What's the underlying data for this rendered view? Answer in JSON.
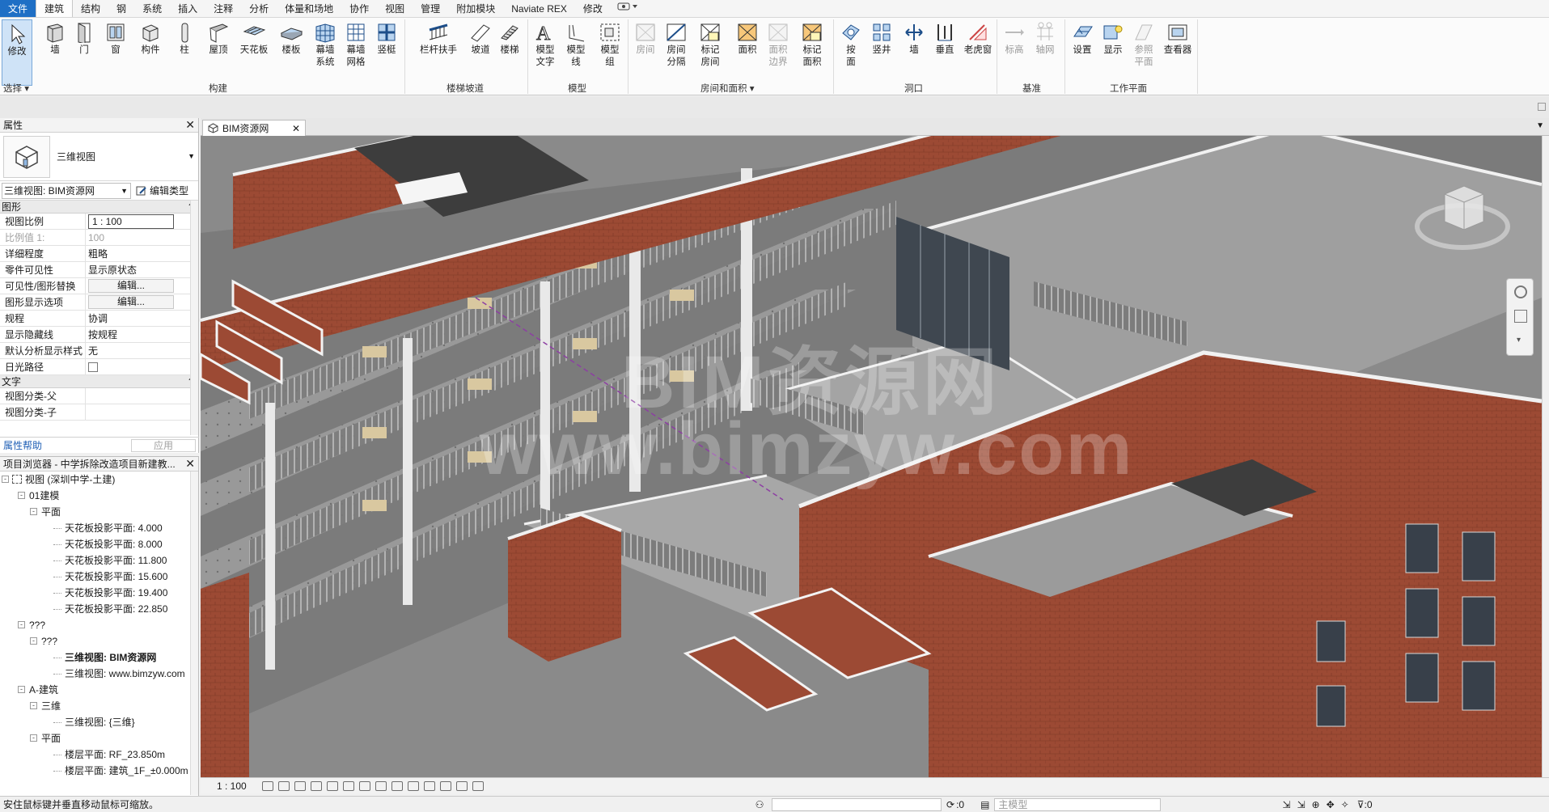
{
  "menu": {
    "tabs": [
      "文件",
      "建筑",
      "结构",
      "钢",
      "系统",
      "插入",
      "注释",
      "分析",
      "体量和场地",
      "协作",
      "视图",
      "管理",
      "附加模块",
      "Naviate REX",
      "修改"
    ],
    "active": "建筑"
  },
  "ribbon": {
    "select_label": "选择",
    "tools": {
      "modify": "修改",
      "wall": "墙",
      "door": "门",
      "window": "窗",
      "component": "构件",
      "column": "柱",
      "roof": "屋顶",
      "ceiling": "天花板",
      "floor": "楼板",
      "curtain_system": "幕墙\n系统",
      "curtain_grid": "幕墙\n网格",
      "mullion": "竖梃",
      "railing": "栏杆扶手",
      "ramp": "坡道",
      "stair": "楼梯",
      "model_text": "模型\n文字",
      "model_line": "模型\n线",
      "model_group": "模型\n组",
      "room": "房间",
      "room_separator": "房间\n分隔",
      "tag_room": "标记\n房间",
      "area": "面积",
      "area_boundary": "面积\n边界",
      "tag_area": "标记\n面积",
      "by_face": "按\n面",
      "shaft": "竖井",
      "wall_opening": "墙",
      "vertical": "垂直",
      "dormer": "老虎窗",
      "level": "标高",
      "grid": "轴网",
      "set": "设置",
      "show": "显示",
      "ref_plane": "参照\n平面",
      "viewer": "查看器"
    },
    "panels": {
      "build": "构建",
      "circulation": "楼梯坡道",
      "model": "模型",
      "room_area": "房间和面积",
      "opening": "洞口",
      "datum": "基准",
      "work_plane": "工作平面"
    }
  },
  "properties": {
    "title": "属性",
    "type_name": "三维视图",
    "instance_selector": "三维视图: BIM资源网",
    "edit_type": "编辑类型",
    "groups": {
      "graphics": "图形",
      "text": "文字"
    },
    "rows": [
      {
        "key": "视图比例",
        "value": "1 : 100",
        "style": "boxed"
      },
      {
        "key": "比例值 1:",
        "value": "100",
        "style": "dim"
      },
      {
        "key": "详细程度",
        "value": "粗略",
        "style": "plain"
      },
      {
        "key": "零件可见性",
        "value": "显示原状态",
        "style": "plain"
      },
      {
        "key": "可见性/图形替换",
        "value": "编辑...",
        "style": "btn"
      },
      {
        "key": "图形显示选项",
        "value": "编辑...",
        "style": "btn"
      },
      {
        "key": "规程",
        "value": "协调",
        "style": "plain"
      },
      {
        "key": "显示隐藏线",
        "value": "按规程",
        "style": "plain"
      },
      {
        "key": "默认分析显示样式",
        "value": "无",
        "style": "plain"
      },
      {
        "key": "日光路径",
        "value": "",
        "style": "check"
      }
    ],
    "text_rows": [
      {
        "key": "视图分类-父",
        "value": ""
      },
      {
        "key": "视图分类-子",
        "value": ""
      }
    ],
    "help_link": "属性帮助",
    "apply_button": "应用"
  },
  "browser": {
    "title": "项目浏览器 - 中学拆除改造项目新建教...",
    "items": [
      {
        "label": "视图 (深圳中学-土建)",
        "level": 0,
        "toggle": "-",
        "icon": true,
        "bold": false
      },
      {
        "label": "01建模",
        "level": 1,
        "toggle": "-",
        "bold": false
      },
      {
        "label": "平面",
        "level": 2,
        "toggle": "-",
        "bold": false
      },
      {
        "label": "天花板投影平面: 4.000",
        "level": 3,
        "toggle": "",
        "bold": false
      },
      {
        "label": "天花板投影平面: 8.000",
        "level": 3,
        "toggle": "",
        "bold": false
      },
      {
        "label": "天花板投影平面: 11.800",
        "level": 3,
        "toggle": "",
        "bold": false
      },
      {
        "label": "天花板投影平面: 15.600",
        "level": 3,
        "toggle": "",
        "bold": false
      },
      {
        "label": "天花板投影平面: 19.400",
        "level": 3,
        "toggle": "",
        "bold": false
      },
      {
        "label": "天花板投影平面: 22.850",
        "level": 3,
        "toggle": "",
        "bold": false
      },
      {
        "label": "???",
        "level": 1,
        "toggle": "-",
        "bold": false
      },
      {
        "label": "???",
        "level": 2,
        "toggle": "-",
        "bold": false
      },
      {
        "label": "三维视图: BIM资源网",
        "level": 3,
        "toggle": "",
        "bold": true
      },
      {
        "label": "三维视图: www.bimzyw.com",
        "level": 3,
        "toggle": "",
        "bold": false
      },
      {
        "label": "A-建筑",
        "level": 1,
        "toggle": "-",
        "bold": false
      },
      {
        "label": "三维",
        "level": 2,
        "toggle": "-",
        "bold": false
      },
      {
        "label": "三维视图: {三维}",
        "level": 3,
        "toggle": "",
        "bold": false
      },
      {
        "label": "平面",
        "level": 2,
        "toggle": "-",
        "bold": false
      },
      {
        "label": "楼层平面: RF_23.850m",
        "level": 3,
        "toggle": "",
        "bold": false
      },
      {
        "label": "楼层平面: 建筑_1F_±0.000m",
        "level": 3,
        "toggle": "",
        "bold": false
      }
    ]
  },
  "view": {
    "tab_title": "BIM资源网",
    "watermark_line1": "BIM资源网",
    "watermark_line2": "www.bimzyw.com",
    "scale": "1 : 100"
  },
  "status": {
    "message": "安住鼠标键并垂直移动鼠标可缩放。",
    "ws_value": ":0",
    "model_label": "主模型",
    "filter_count": ":0"
  },
  "colors": {
    "brick": "#9c4a34",
    "floor": "#8e8e8e",
    "slab_top": "#b5b5b5",
    "beige": "#d9c8a0",
    "accent": "#1f6fc5"
  }
}
